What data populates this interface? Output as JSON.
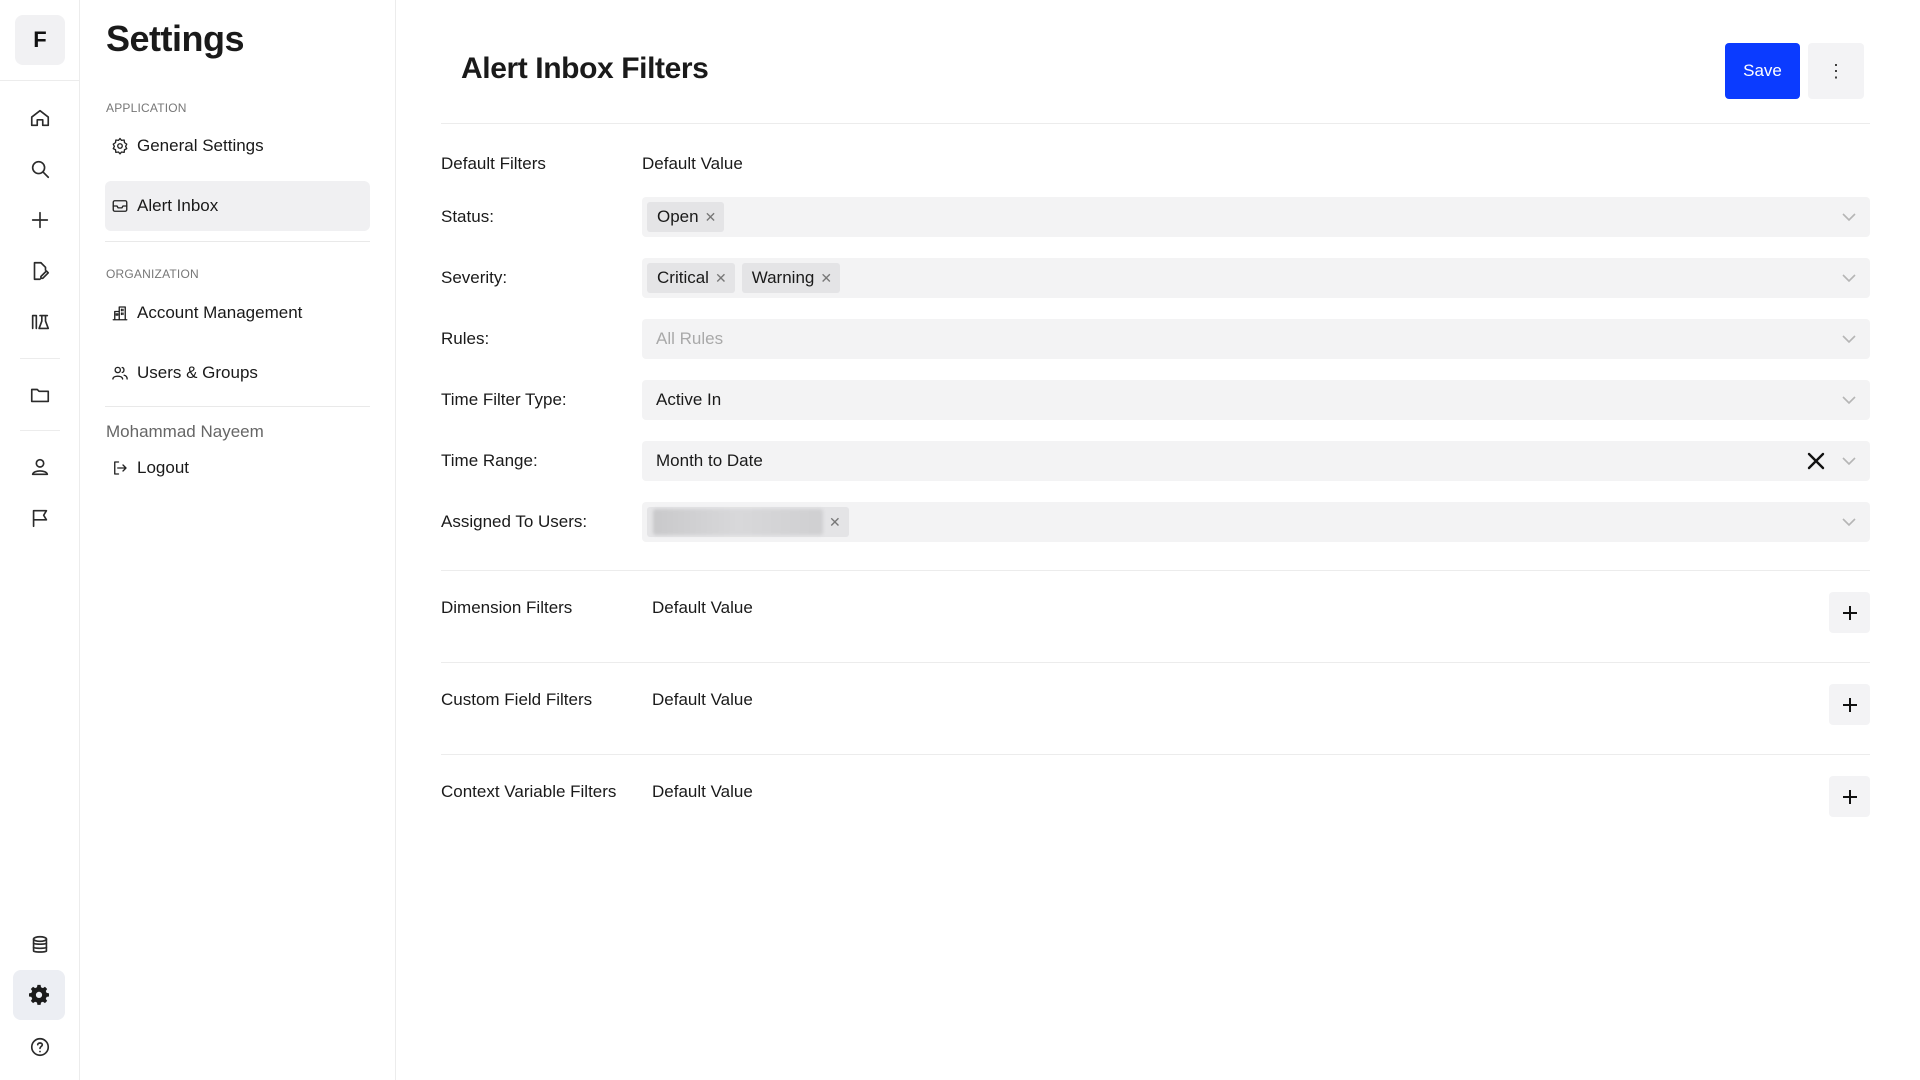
{
  "rail": {
    "logo": "F",
    "icons": [
      "home-icon",
      "search-icon",
      "plus-icon",
      "edit-doc-icon",
      "library-icon",
      "folder-icon",
      "user-icon",
      "flag-icon",
      "database-icon",
      "gear-icon",
      "help-icon"
    ],
    "active": "gear-icon"
  },
  "sidebar": {
    "title": "Settings",
    "sections": [
      {
        "label": "APPLICATION",
        "items": [
          {
            "label": "General Settings",
            "icon": "gear-outline-icon"
          },
          {
            "label": "Alert Inbox",
            "icon": "inbox-icon",
            "active": true
          }
        ]
      },
      {
        "label": "ORGANIZATION",
        "items": [
          {
            "label": "Account Management",
            "icon": "building-icon"
          },
          {
            "label": "Users & Groups",
            "icon": "users-icon"
          }
        ]
      }
    ],
    "user_name": "Mohammad Nayeem",
    "logout_label": "Logout"
  },
  "header": {
    "title": "Alert Inbox Filters",
    "save_label": "Save",
    "more_label": "⋮"
  },
  "default_filters": {
    "heading": "Default Filters",
    "value_heading": "Default Value",
    "status": {
      "label": "Status",
      "tags": [
        "Open"
      ]
    },
    "severity": {
      "label": "Severity",
      "tags": [
        "Critical",
        "Warning"
      ]
    },
    "rules": {
      "label": "Rules",
      "placeholder": "All Rules"
    },
    "time_filter_type": {
      "label": "Time Filter Type",
      "value": "Active In"
    },
    "time_range": {
      "label": "Time Range",
      "value": "Month to Date"
    },
    "assigned_to_users": {
      "label": "Assigned To Users",
      "tags": [
        "[redacted]"
      ]
    }
  },
  "dimension_filters": {
    "heading": "Dimension Filters",
    "value_heading": "Default Value"
  },
  "custom_field_filters": {
    "heading": "Custom Field Filters",
    "value_heading": "Default Value"
  },
  "context_variable_filters": {
    "heading": "Context Variable Filters",
    "value_heading": "Default Value"
  },
  "colors": {
    "primary": "#0b3bff",
    "field_bg": "#f3f3f4",
    "tag_bg": "#e4e4e6"
  }
}
